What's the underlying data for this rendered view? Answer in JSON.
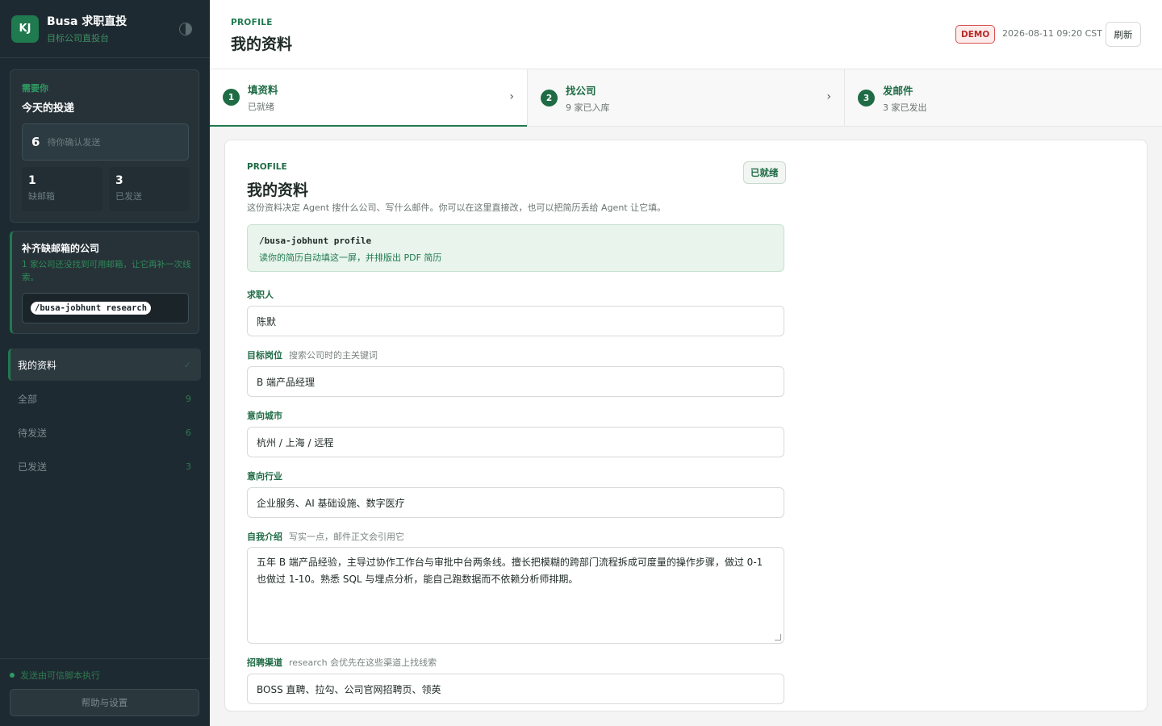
{
  "sidebar": {
    "logo": "KJ",
    "title": "Busa 求职直投",
    "subtitle": "目标公司直投台",
    "today": {
      "kicker": "需要你",
      "title": "今天的投递",
      "pending_count": "6",
      "pending_label": "待你确认发送",
      "missing_count": "1",
      "missing_label": "缺邮箱",
      "sent_count": "3",
      "sent_label": "已发送"
    },
    "research": {
      "title": "补齐缺邮箱的公司",
      "desc": "1 家公司还没找到可用邮箱，让它再补一次线索。",
      "command": "/busa-jobhunt research"
    },
    "nav": [
      {
        "label": "我的资料",
        "count": "✓"
      },
      {
        "label": "全部",
        "count": "9"
      },
      {
        "label": "待发送",
        "count": "6"
      },
      {
        "label": "已发送",
        "count": "3"
      }
    ],
    "exec_status": "发送由可信脚本执行",
    "help_label": "帮助与设置"
  },
  "header": {
    "kicker": "PROFILE",
    "title": "我的资料",
    "badge": "DEMO",
    "timestamp": "2026-08-11 09:20 CST",
    "refresh_label": "刷新"
  },
  "steps": [
    {
      "num": "1",
      "title": "填资料",
      "sub": "已就绪"
    },
    {
      "num": "2",
      "title": "找公司",
      "sub": "9 家已入库"
    },
    {
      "num": "3",
      "title": "发邮件",
      "sub": "3 家已发出"
    }
  ],
  "panel": {
    "kicker": "PROFILE",
    "title": "我的资料",
    "desc": "这份资料决定 Agent 搜什么公司、写什么邮件。你可以在这里直接改，也可以把简历丢给 Agent 让它填。",
    "status_label": "已就绪",
    "tip_command": "/busa-jobhunt profile",
    "tip_text": "读你的简历自动填这一屏，并排版出 PDF 简历",
    "fields": {
      "name": {
        "label": "求职人",
        "value": "陈默"
      },
      "role": {
        "label": "目标岗位",
        "hint": "搜索公司时的主关键词",
        "value": "B 端产品经理"
      },
      "city": {
        "label": "意向城市",
        "value": "杭州 / 上海 / 远程"
      },
      "industry": {
        "label": "意向行业",
        "value": "企业服务、AI 基础设施、数字医疗"
      },
      "intro": {
        "label": "自我介绍",
        "hint": "写实一点，邮件正文会引用它",
        "value": "五年 B 端产品经验，主导过协作工作台与审批中台两条线。擅长把模糊的跨部门流程拆成可度量的操作步骤，做过 0-1 也做过 1-10。熟悉 SQL 与埋点分析，能自己跑数据而不依赖分析师排期。"
      },
      "channel": {
        "label": "招聘渠道",
        "hint": "research 会优先在这些渠道上找线索",
        "value": "BOSS 直聘、拉勾、公司官网招聘页、领英"
      }
    }
  },
  "colors": {
    "accent": "#1f7a4f",
    "sidebar_bg": "#1e2a31",
    "demo_badge": "#b52a27"
  }
}
